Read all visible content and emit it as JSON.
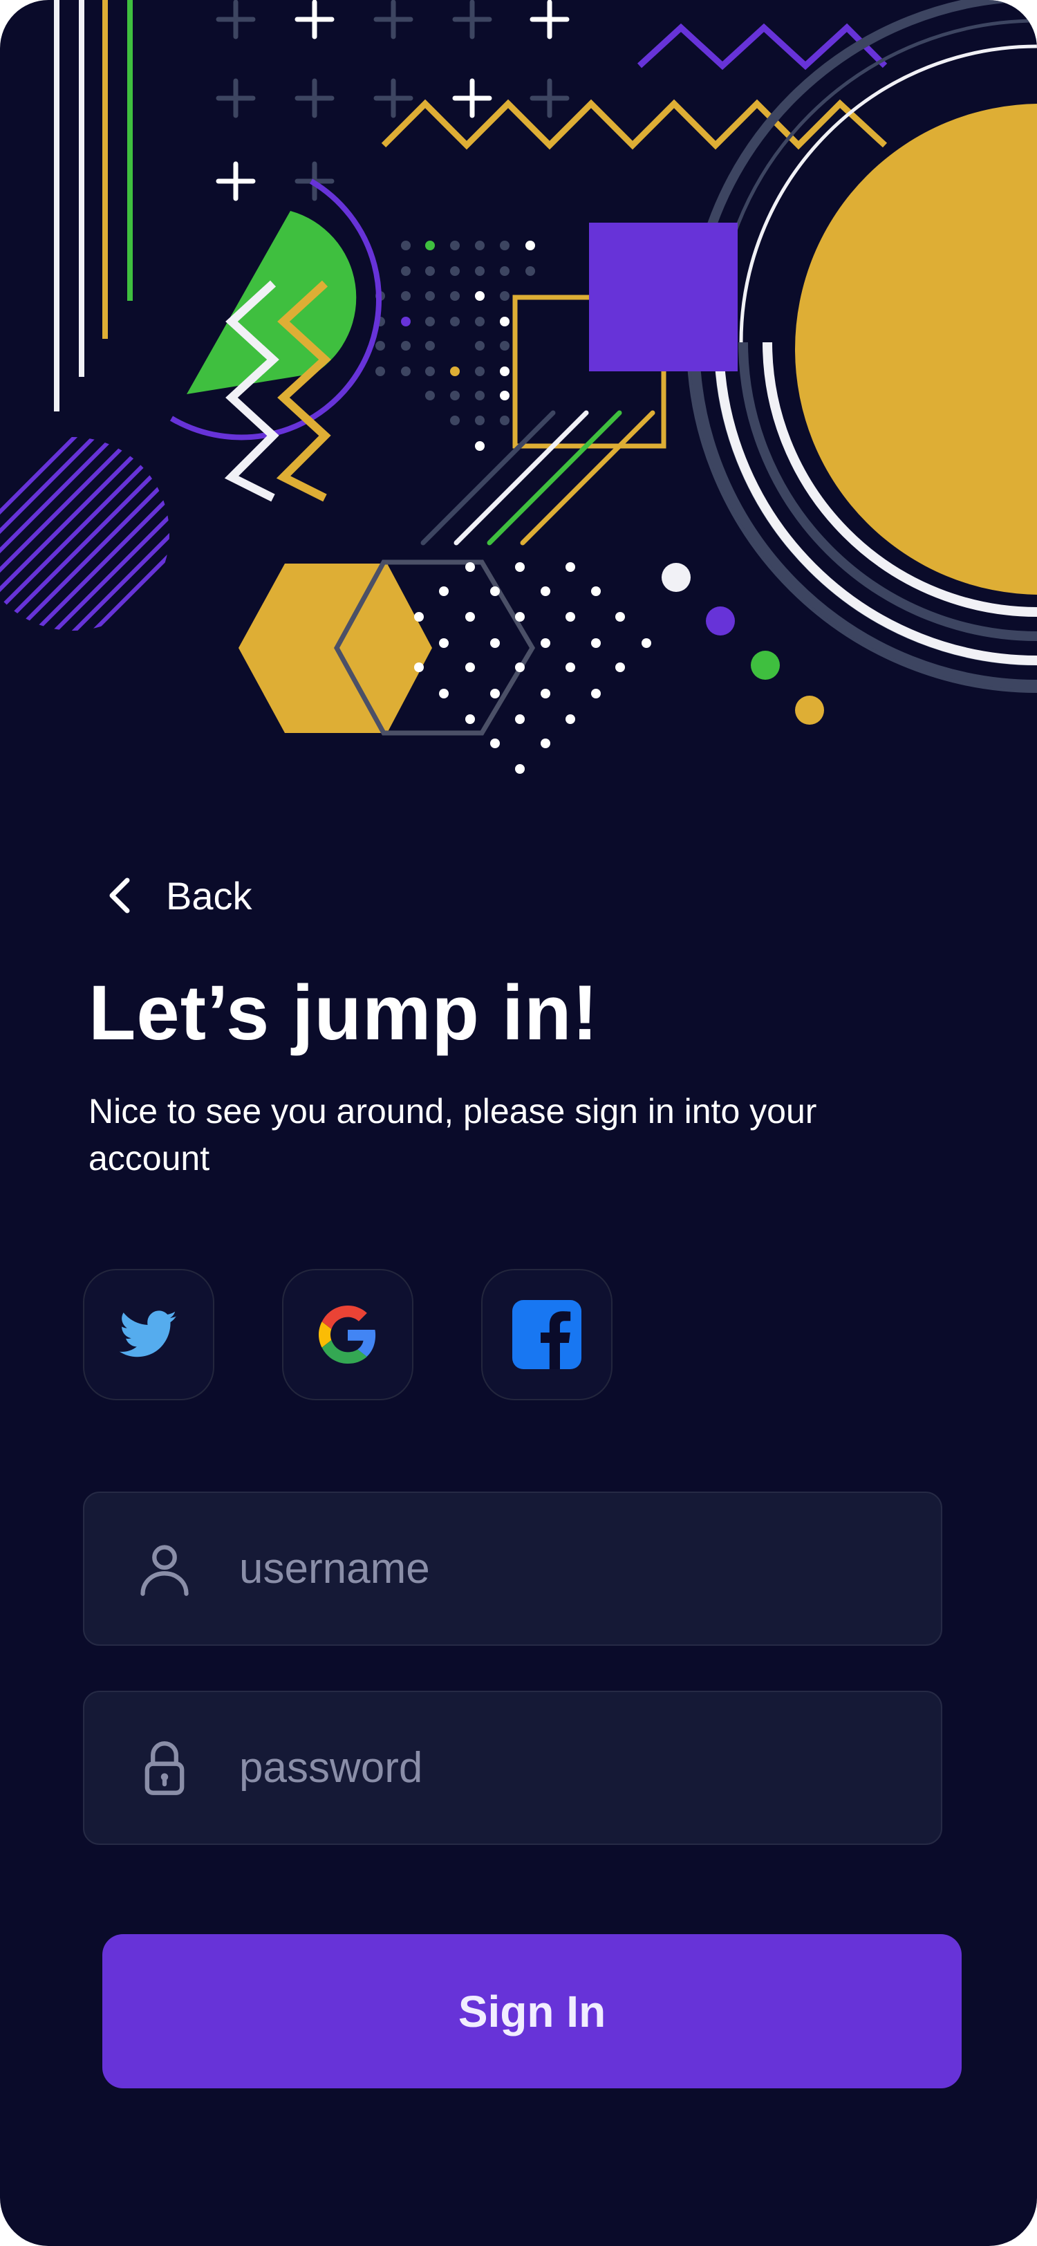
{
  "header": {
    "back_label": "Back"
  },
  "main": {
    "title": "Let’s jump in!",
    "subtitle": "Nice to see you around, please sign in into your account"
  },
  "social": [
    {
      "icon": "twitter-icon",
      "color": "#55acee"
    },
    {
      "icon": "google-icon",
      "colors": [
        "#ea4335",
        "#fbbc05",
        "#34a853",
        "#4285f4"
      ]
    },
    {
      "icon": "facebook-icon",
      "color": "#1877f2"
    }
  ],
  "form": {
    "username": {
      "placeholder": "username",
      "value": "",
      "icon": "user-icon"
    },
    "password": {
      "placeholder": "password",
      "value": "",
      "icon": "lock-icon"
    },
    "submit_label": "Sign In"
  },
  "colors": {
    "background": "#0a0b2a",
    "accent": "#6733d8",
    "yellow": "#deae35",
    "green": "#3fbf3f",
    "field": "#151936"
  }
}
